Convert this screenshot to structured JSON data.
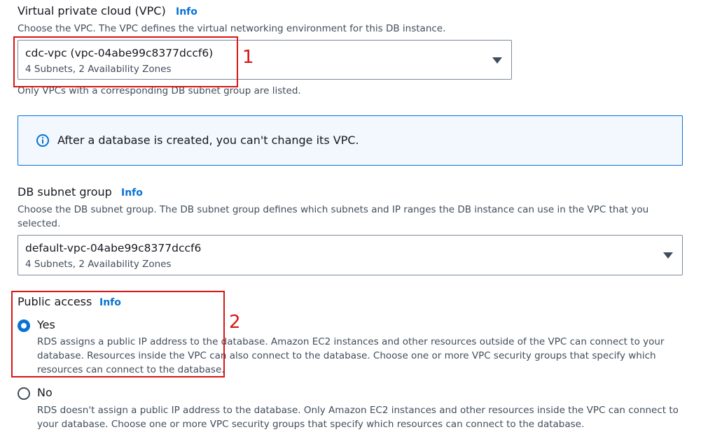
{
  "vpc": {
    "label": "Virtual private cloud (VPC)",
    "info": "Info",
    "description": "Choose the VPC. The VPC defines the virtual networking environment for this DB instance.",
    "selected_value": "cdc-vpc (vpc-04abe99c8377dccf6)",
    "selected_detail": "4 Subnets, 2 Availability Zones",
    "note": "Only VPCs with a corresponding DB subnet group are listed."
  },
  "alert": {
    "text": "After a database is created, you can't change its VPC."
  },
  "subnet_group": {
    "label": "DB subnet group",
    "info": "Info",
    "description_line1": "Choose the DB subnet group. The DB subnet group defines which subnets and IP ranges the DB instance can use in the VPC that you",
    "description_line2": "selected.",
    "selected_value": "default-vpc-04abe99c8377dccf6",
    "selected_detail": "4 Subnets, 2 Availability Zones"
  },
  "public_access": {
    "label": "Public access",
    "info": "Info",
    "options": [
      {
        "label": "Yes",
        "checked": true,
        "desc_line1": "RDS assigns a public IP address to the database. Amazon EC2 instances and other resources outside of the VPC can connect to your",
        "desc_line2": "database. Resources inside the VPC can also connect to the database. Choose one or more VPC security groups that specify which",
        "desc_line3": "resources can connect to the database."
      },
      {
        "label": "No",
        "checked": false,
        "desc_line1": "RDS doesn't assign a public IP address to the database. Only Amazon EC2 instances and other resources inside the VPC can connect to",
        "desc_line2": "your database. Choose one or more VPC security groups that specify which resources can connect to the database."
      }
    ]
  },
  "annotations": {
    "marker_1": "1",
    "marker_2": "2"
  },
  "colors": {
    "accent": "#0972d3",
    "annotation_red": "#d91515",
    "alert_background": "#f2f8fd"
  },
  "icons": {
    "alert_icon": "info-circle-icon",
    "select_caret": "caret-down-icon"
  }
}
